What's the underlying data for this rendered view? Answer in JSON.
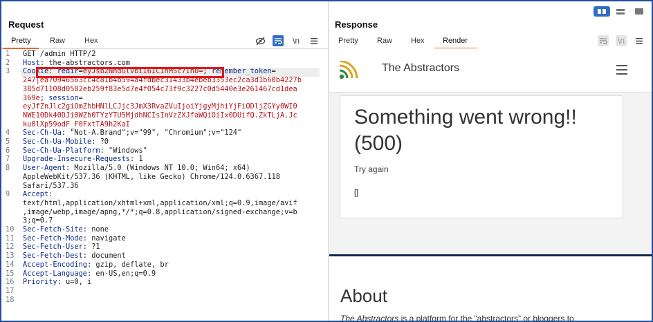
{
  "request": {
    "title": "Request",
    "tabs": [
      "Pretty",
      "Raw",
      "Hex"
    ],
    "toolbar_newline": "\\n",
    "lines": [
      {
        "n": "1",
        "parts": [
          {
            "c": "",
            "t": "GET /admin HTTP/2"
          }
        ]
      },
      {
        "n": "2",
        "parts": [
          {
            "c": "k",
            "t": "Host"
          },
          {
            "c": "",
            "t": ": the-abstractors.com"
          }
        ]
      },
      {
        "n": "3",
        "parts": [
          {
            "c": "k",
            "t": "Cookie"
          },
          {
            "c": "",
            "t": ": "
          },
          {
            "c": "k",
            "t": "redir"
          },
          {
            "c": "",
            "t": "="
          },
          {
            "c": "r",
            "t": "eyJsb2NhdGlvbiI6ICInMSc7In0="
          },
          {
            "c": "",
            "t": "; "
          },
          {
            "c": "k",
            "t": "remember_token"
          },
          {
            "c": "",
            "t": "="
          }
        ]
      },
      {
        "n": "",
        "parts": [
          {
            "c": "r",
            "t": "247|ea70946563cc4c81b4b594a4fdbec31433b4ebeb3353ec2ca3d1b60b4227b"
          }
        ]
      },
      {
        "n": "",
        "parts": [
          {
            "c": "r",
            "t": "385d71108d0582eb259f83e5d7e4f054c73f9c3227c0d5440e3e261467cd1dea"
          }
        ]
      },
      {
        "n": "",
        "parts": [
          {
            "c": "r",
            "t": "369e"
          },
          {
            "c": "",
            "t": "; "
          },
          {
            "c": "k",
            "t": "session"
          },
          {
            "c": "",
            "t": "="
          }
        ]
      },
      {
        "n": "",
        "parts": [
          {
            "c": "r",
            "t": "eyJfZnJlc2giOmZhbHNlLCJjc3JmX3RvaZVuIjoiYjgyMjhiYjFiODljZGYy0WI0"
          }
        ]
      },
      {
        "n": "",
        "parts": [
          {
            "c": "r",
            "t": "NWE10Dk40DJi0WZh0TYzYTU5MjdhNCIsInVzZXJfaWQiOiIx0DUifQ.ZkTLjA.Jc"
          }
        ]
      },
      {
        "n": "",
        "parts": [
          {
            "c": "r",
            "t": "ku0lXp59odF_F0FxtTA9h2KaI"
          }
        ]
      },
      {
        "n": "4",
        "parts": [
          {
            "c": "k",
            "t": "Sec-Ch-Ua"
          },
          {
            "c": "",
            "t": ": \"Not-A.Brand\";v=\"99\", \"Chromium\";v=\"124\""
          }
        ]
      },
      {
        "n": "5",
        "parts": [
          {
            "c": "k",
            "t": "Sec-Ch-Ua-Mobile"
          },
          {
            "c": "",
            "t": ": ?0"
          }
        ]
      },
      {
        "n": "6",
        "parts": [
          {
            "c": "k",
            "t": "Sec-Ch-Ua-Platform"
          },
          {
            "c": "",
            "t": ": \"Windows\""
          }
        ]
      },
      {
        "n": "7",
        "parts": [
          {
            "c": "k",
            "t": "Upgrade-Insecure-Requests"
          },
          {
            "c": "",
            "t": ": 1"
          }
        ]
      },
      {
        "n": "8",
        "parts": [
          {
            "c": "k",
            "t": "User-Agent"
          },
          {
            "c": "",
            "t": ": Mozilla/5.0 (Windows NT 10.0; Win64; x64)"
          }
        ]
      },
      {
        "n": "",
        "parts": [
          {
            "c": "",
            "t": "AppleWebKit/537.36 (KHTML, like Gecko) Chrome/124.0.6367.118"
          }
        ]
      },
      {
        "n": "",
        "parts": [
          {
            "c": "",
            "t": "Safari/537.36"
          }
        ]
      },
      {
        "n": "9",
        "parts": [
          {
            "c": "k",
            "t": "Accept"
          },
          {
            "c": "",
            "t": ":"
          }
        ]
      },
      {
        "n": "",
        "parts": [
          {
            "c": "",
            "t": "text/html,application/xhtml+xml,application/xml;q=0.9,image/avif"
          }
        ]
      },
      {
        "n": "",
        "parts": [
          {
            "c": "",
            "t": ",image/webp,image/apng,*/*;q=0.8,application/signed-exchange;v=b"
          }
        ]
      },
      {
        "n": "",
        "parts": [
          {
            "c": "",
            "t": "3;q=0.7"
          }
        ]
      },
      {
        "n": "10",
        "parts": [
          {
            "c": "k",
            "t": "Sec-Fetch-Site"
          },
          {
            "c": "",
            "t": ": none"
          }
        ]
      },
      {
        "n": "11",
        "parts": [
          {
            "c": "k",
            "t": "Sec-Fetch-Mode"
          },
          {
            "c": "",
            "t": ": navigate"
          }
        ]
      },
      {
        "n": "12",
        "parts": [
          {
            "c": "k",
            "t": "Sec-Fetch-User"
          },
          {
            "c": "",
            "t": ": ?1"
          }
        ]
      },
      {
        "n": "13",
        "parts": [
          {
            "c": "k",
            "t": "Sec-Fetch-Dest"
          },
          {
            "c": "",
            "t": ": document"
          }
        ]
      },
      {
        "n": "14",
        "parts": [
          {
            "c": "k",
            "t": "Accept-Encoding"
          },
          {
            "c": "",
            "t": ": gzip, deflate, br"
          }
        ]
      },
      {
        "n": "15",
        "parts": [
          {
            "c": "k",
            "t": "Accept-Language"
          },
          {
            "c": "",
            "t": ": en-US,en;q=0.9"
          }
        ]
      },
      {
        "n": "16",
        "parts": [
          {
            "c": "k",
            "t": "Priority"
          },
          {
            "c": "",
            "t": ": u=0, i"
          }
        ]
      },
      {
        "n": "17",
        "parts": []
      },
      {
        "n": "18",
        "parts": []
      }
    ]
  },
  "response": {
    "title": "Response",
    "tabs": [
      "Pretty",
      "Raw",
      "Hex",
      "Render"
    ],
    "toolbar_newline": "\\n",
    "site_name": "The Abstractors",
    "error_heading": "Something went wrong!! (500)",
    "try_again": "Try again",
    "brackets": "[]",
    "about_title": "About",
    "about_em": "The Abstractors",
    "about_text": " is a platform for the “abstractors” or bloggers to"
  },
  "colors": {
    "accent": "#e8692a",
    "toolbar_blue": "#2f6fc0",
    "header_key": "#0b2e8a",
    "cookie_value": "#b8141a",
    "highlight_box": "#e01717"
  }
}
